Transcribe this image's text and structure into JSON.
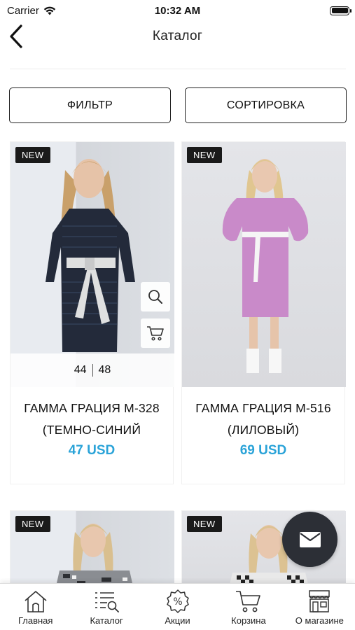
{
  "status_bar": {
    "carrier": "Carrier",
    "time": "10:32 AM"
  },
  "nav": {
    "title": "Каталог"
  },
  "toolbar": {
    "filter_label": "ФИЛЬТР",
    "sort_label": "СОРТИРОВКА"
  },
  "products": [
    {
      "badge": "NEW",
      "name_line1": "ГАММА ГРАЦИЯ М-328",
      "name_line2": "(ТЕМНО-СИНИЙ",
      "price": "47 USD",
      "sizes": [
        "44",
        "48"
      ]
    },
    {
      "badge": "NEW",
      "name_line1": "ГАММА ГРАЦИЯ М-516",
      "name_line2": "(ЛИЛОВЫЙ)",
      "price": "69 USD"
    },
    {
      "badge": "NEW"
    },
    {
      "badge": "NEW"
    }
  ],
  "tab_bar": {
    "items": [
      {
        "label": "Главная",
        "icon": "home-icon"
      },
      {
        "label": "Каталог",
        "icon": "catalog-icon"
      },
      {
        "label": "Акции",
        "icon": "discount-icon"
      },
      {
        "label": "Корзина",
        "icon": "cart-icon"
      },
      {
        "label": "О магазине",
        "icon": "store-icon"
      }
    ]
  },
  "colors": {
    "price": "#2aa3d8",
    "fab": "#2c2f36",
    "badge": "#1a1a1a"
  }
}
